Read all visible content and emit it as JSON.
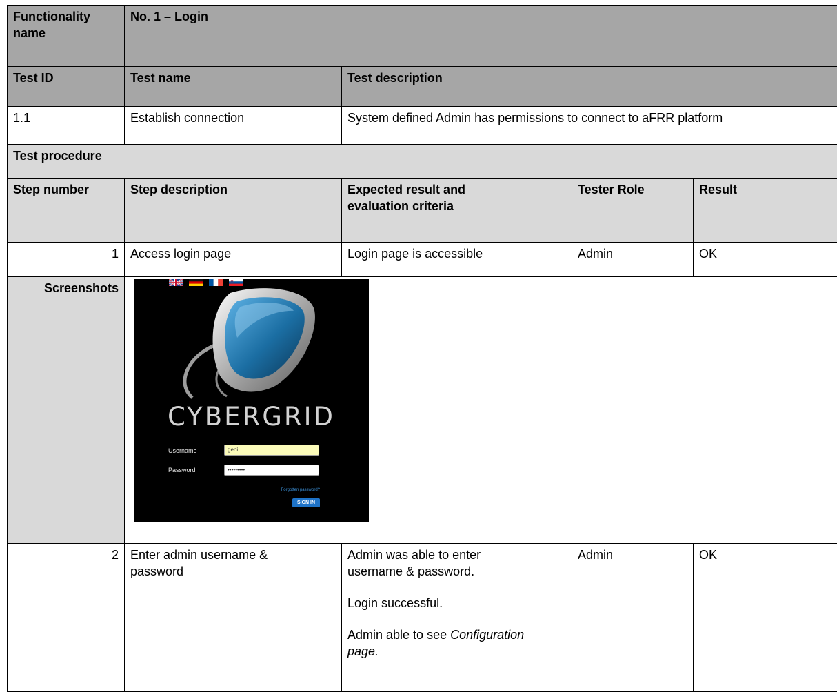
{
  "functionality": {
    "label": "Functionality name",
    "value": "No. 1 –  Login"
  },
  "test_header": {
    "id_label": "Test ID",
    "name_label": "Test name",
    "description_label": "Test description"
  },
  "test": {
    "id": "1.1",
    "name": "Establish connection",
    "description": "System defined Admin has permissions to connect to aFRR platform"
  },
  "procedure_label": "Test procedure",
  "steps_header": {
    "step_number": "Step number",
    "step_description": "Step description",
    "expected_line1": "Expected result and",
    "expected_line2": "evaluation criteria",
    "tester_role": "Tester Role",
    "result": "Result"
  },
  "steps": [
    {
      "number": "1",
      "description": "Access login page",
      "expected": "Login page is accessible",
      "role": "Admin",
      "result": "OK"
    },
    {
      "number": "2",
      "description_line1": "Enter admin username &",
      "description_line2": "password",
      "expected_p1_line1": "Admin was able to enter",
      "expected_p1_line2": "username & password.",
      "expected_p2": "Login successful.",
      "expected_p3_prefix": "Admin able to see ",
      "expected_p3_em1": "Configuration",
      "expected_p3_em2": "page.",
      "role": "Admin",
      "result": "OK"
    }
  ],
  "screenshots_label": "Screenshots",
  "login_screenshot": {
    "brand": "CYBERGRID",
    "username_label": "Username",
    "username_value": "geni",
    "password_label": "Password",
    "password_value": "•••••••••",
    "forgot_link": "Forgotten password?",
    "sign_in": "SIGN IN",
    "flags": [
      "uk-flag",
      "germany-flag",
      "france-flag",
      "slovenia-flag"
    ],
    "colors": {
      "background": "#000000",
      "field_highlight": "#fbfbb9",
      "button": "#1e73c8",
      "link": "#3b8fd6"
    }
  }
}
